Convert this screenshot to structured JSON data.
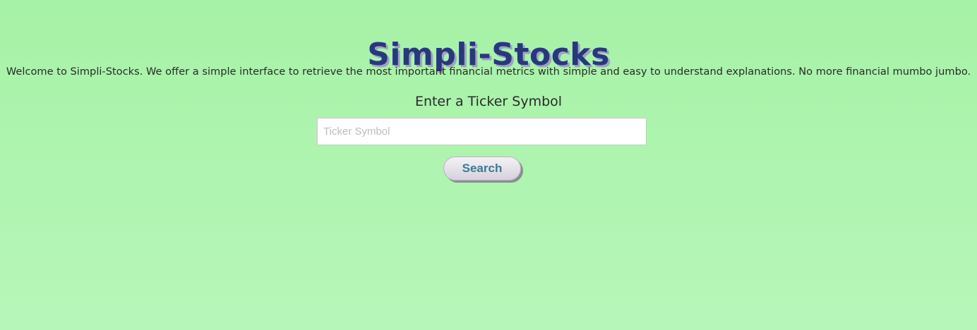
{
  "header": {
    "title": "Simpli-Stocks"
  },
  "intro": {
    "text": "Welcome to Simpli-Stocks. We offer a simple interface to retrieve the most important financial metrics with simple and easy to understand explanations. No more financial mumbo jumbo."
  },
  "search": {
    "prompt": "Enter a Ticker Symbol",
    "placeholder": "Ticker Symbol",
    "value": "",
    "button_label": "Search"
  },
  "colors": {
    "background_top": "#a6f2a6",
    "background_bottom": "#b7f6b9",
    "title": "#27397a",
    "button_text": "#3b7b97"
  }
}
